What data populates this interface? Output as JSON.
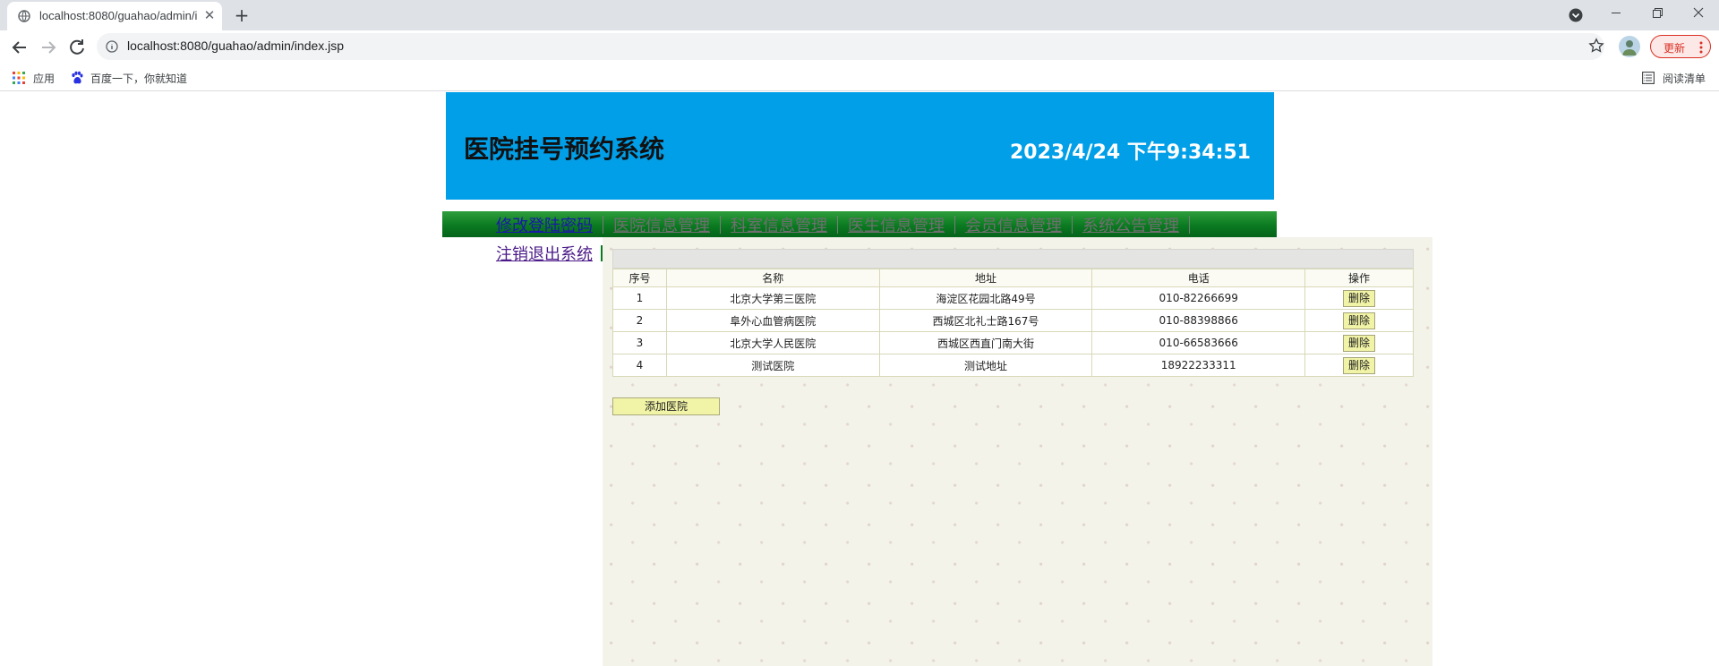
{
  "browser": {
    "tab_title": "localhost:8080/guahao/admin/index.jsp",
    "url": "localhost:8080/guahao/admin/index.jsp",
    "update_label": "更新",
    "bookmarks": [
      "应用",
      "百度一下，你就知道"
    ],
    "reading_list": "阅读清单"
  },
  "header": {
    "title": "医院挂号预约系统",
    "clock": "2023/4/24 下午9:34:51",
    "bg_color": "#019fe8"
  },
  "nav": {
    "items": [
      "修改登陆密码",
      "医院信息管理",
      "科室信息管理",
      "医生信息管理",
      "会员信息管理",
      "系统公告管理"
    ],
    "logout": "注销退出系统",
    "bar_color": "#0a7a21"
  },
  "table": {
    "columns": [
      "序号",
      "名称",
      "地址",
      "电话",
      "操作"
    ],
    "delete_label": "删除",
    "rows": [
      {
        "index": "1",
        "name": "北京大学第三医院",
        "address": "海淀区花园北路49号",
        "phone": "010-82266699"
      },
      {
        "index": "2",
        "name": "阜外心血管病医院",
        "address": "西城区北礼士路167号",
        "phone": "010-88398866"
      },
      {
        "index": "3",
        "name": "北京大学人民医院",
        "address": "西城区西直门南大街",
        "phone": "010-66583666"
      },
      {
        "index": "4",
        "name": "测试医院",
        "address": "测试地址",
        "phone": "18922233311"
      }
    ]
  },
  "add_button": "添加医院"
}
